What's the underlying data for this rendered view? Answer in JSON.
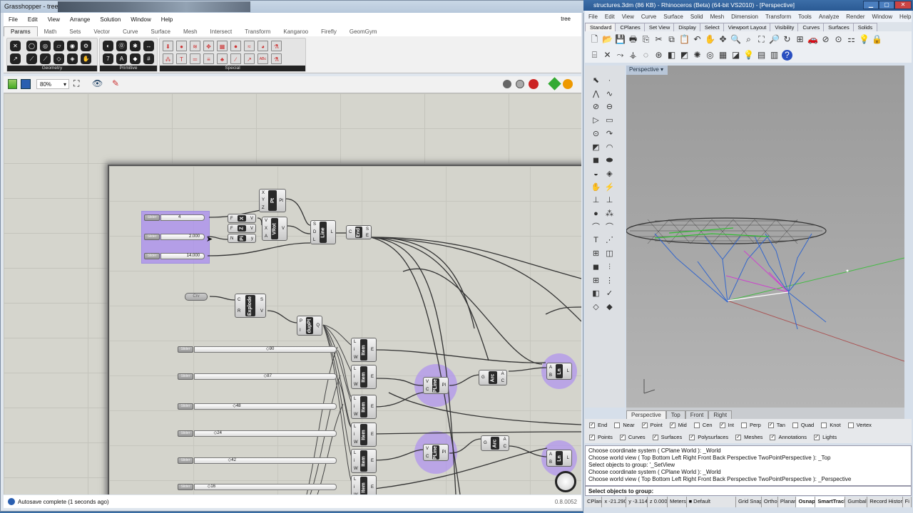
{
  "gh": {
    "title": "Grasshopper - tree",
    "doc_name": "tree",
    "menu": [
      "File",
      "Edit",
      "View",
      "Arrange",
      "Solution",
      "Window",
      "Help"
    ],
    "tabs": [
      "Params",
      "Math",
      "Sets",
      "Vector",
      "Curve",
      "Surface",
      "Mesh",
      "Intersect",
      "Transform",
      "Kangaroo",
      "Firefly",
      "GeomGym"
    ],
    "active_tab": "Params",
    "ribbon_groups": [
      {
        "label": "Geometry",
        "icons": [
          "✕",
          "◯",
          "◎",
          "▱",
          "◉",
          "⚙",
          "↗",
          "⟋",
          "⟋",
          "◇",
          "◈",
          "✋"
        ]
      },
      {
        "label": "Primitive",
        "icons": [
          "◐",
          "⓪",
          "✱",
          "↔",
          "7",
          "A",
          "◆",
          "#"
        ]
      },
      {
        "label": "Special",
        "icons": [
          "⬇",
          "●",
          "≋",
          "✥",
          "▦",
          "⏺",
          "≈",
          "◕",
          "⚗",
          "⁂",
          "T",
          "═",
          "≡",
          "♣",
          "∕",
          "↗",
          "ᴬᴮᶜ",
          "⚗"
        ]
      }
    ],
    "zoom": "80%",
    "status": "Autosave complete (1 seconds ago)",
    "version": "0.8.0052",
    "sliders_small": [
      {
        "label": "Slider",
        "value": "4"
      },
      {
        "label": "Slider",
        "value": "2.000"
      },
      {
        "label": "Slider",
        "value": "14.000"
      }
    ],
    "crv_param": "Crv",
    "sliders_long": {
      "max": 180,
      "items": [
        {
          "label": "Slider",
          "value": 90
        },
        {
          "label": "Slider",
          "value": 87
        },
        {
          "label": "Slider",
          "value": 48
        },
        {
          "label": "Slider",
          "value": 24
        },
        {
          "label": "Slider",
          "value": 42
        },
        {
          "label": "Slider",
          "value": 16
        }
      ]
    },
    "components": [
      {
        "name": "Pt",
        "in": [
          "X",
          "Y",
          "Z"
        ],
        "out": [
          "Pt"
        ]
      },
      {
        "name": "X",
        "in": [
          "F"
        ],
        "out": [
          "V"
        ]
      },
      {
        "name": "Z",
        "in": [
          "F"
        ],
        "out": [
          "V"
        ]
      },
      {
        "name": "Pi",
        "in": [
          "N"
        ],
        "out": [
          "y"
        ]
      },
      {
        "name": "VRot",
        "in": [
          "V",
          "X",
          "A"
        ],
        "out": [
          "V"
        ]
      },
      {
        "name": "Line",
        "in": [
          "S",
          "D",
          "L"
        ],
        "out": [
          "L"
        ]
      },
      {
        "name": "End",
        "in": [
          "C"
        ],
        "out": [
          "S",
          "E"
        ]
      },
      {
        "name": "Explode",
        "in": [
          "C",
          "R"
        ],
        "out": [
          "S",
          "V"
        ]
      },
      {
        "name": "dupPt",
        "in": [
          "P",
          "I"
        ],
        "out": [
          "Q"
        ]
      },
      {
        "name": "Item",
        "in": [
          "L",
          "i",
          "W"
        ],
        "out": [
          "E"
        ]
      },
      {
        "name": "Item",
        "in": [
          "L",
          "i",
          "W"
        ],
        "out": [
          "E"
        ]
      },
      {
        "name": "Item",
        "in": [
          "L",
          "i",
          "W"
        ],
        "out": [
          "E"
        ]
      },
      {
        "name": "Item",
        "in": [
          "L",
          "i",
          "W"
        ],
        "out": [
          "E"
        ]
      },
      {
        "name": "Item",
        "in": [
          "L",
          "i",
          "W"
        ],
        "out": [
          "E"
        ]
      },
      {
        "name": "Item",
        "in": [
          "L",
          "i",
          "W"
        ],
        "out": [
          "E"
        ]
      },
      {
        "name": "PLine",
        "in": [
          "V",
          "C"
        ],
        "out": [
          "Pl"
        ]
      },
      {
        "name": "PLine",
        "in": [
          "V",
          "C"
        ],
        "out": [
          "Pl"
        ]
      },
      {
        "name": "Arc",
        "in": [
          "G"
        ],
        "out": [
          "A",
          "C"
        ]
      },
      {
        "name": "Arc",
        "in": [
          "G"
        ],
        "out": [
          "A",
          "C"
        ]
      },
      {
        "name": "Ln",
        "in": [
          "A",
          "B"
        ],
        "out": [
          "L"
        ]
      },
      {
        "name": "Ln",
        "in": [
          "A",
          "B"
        ],
        "out": [
          "L"
        ]
      }
    ]
  },
  "rhino": {
    "title": "structures.3dm (86 KB) - Rhinoceros (Beta) (64-bit VS2010) - [Perspective]",
    "menu": [
      "File",
      "Edit",
      "View",
      "Curve",
      "Surface",
      "Solid",
      "Mesh",
      "Dimension",
      "Transform",
      "Tools",
      "Analyze",
      "Render",
      "Window",
      "Help"
    ],
    "toolbar_tabs": [
      "Standard",
      "CPlanes",
      "Set View",
      "Display",
      "Select",
      "Viewport Layout",
      "Visibility",
      "Curves",
      "Surfaces",
      "Solids"
    ],
    "viewport_label": "Perspective",
    "viewport_tabs": [
      "Perspective",
      "Top",
      "Front",
      "Right"
    ],
    "osnaps": [
      {
        "label": "End",
        "on": true
      },
      {
        "label": "Near",
        "on": false
      },
      {
        "label": "Point",
        "on": true
      },
      {
        "label": "Mid",
        "on": true
      },
      {
        "label": "Cen",
        "on": false
      },
      {
        "label": "Int",
        "on": true
      },
      {
        "label": "Perp",
        "on": false
      },
      {
        "label": "Tan",
        "on": true
      },
      {
        "label": "Quad",
        "on": false
      },
      {
        "label": "Knot",
        "on": false
      },
      {
        "label": "Vertex",
        "on": false
      }
    ],
    "filters": [
      {
        "label": "Points",
        "on": true
      },
      {
        "label": "Curves",
        "on": true
      },
      {
        "label": "Surfaces",
        "on": true
      },
      {
        "label": "Polysurfaces",
        "on": true
      },
      {
        "label": "Meshes",
        "on": true
      },
      {
        "label": "Annotations",
        "on": true
      },
      {
        "label": "Lights",
        "on": true
      }
    ],
    "history": [
      "Choose coordinate system ( CPlane  World ): _World",
      "Choose world view ( Top  Bottom  Left  Right  Front  Back  Perspective  TwoPointPerspective ): _Top",
      "Select objects to group: '_SetView",
      "Choose coordinate system ( CPlane  World ): _World",
      "Choose world view ( Top  Bottom  Left  Right  Front  Back  Perspective  TwoPointPerspective ): _Perspective"
    ],
    "prompt": "Select objects to group:",
    "status": [
      "CPlan",
      "x -21.290",
      "y -3.114",
      "z 0.000",
      "Meters",
      "Default",
      "Grid Snap",
      "Ortho",
      "Planar",
      "Osnap",
      "SmartTrack",
      "Gumball",
      "Record History",
      "Fi"
    ]
  }
}
